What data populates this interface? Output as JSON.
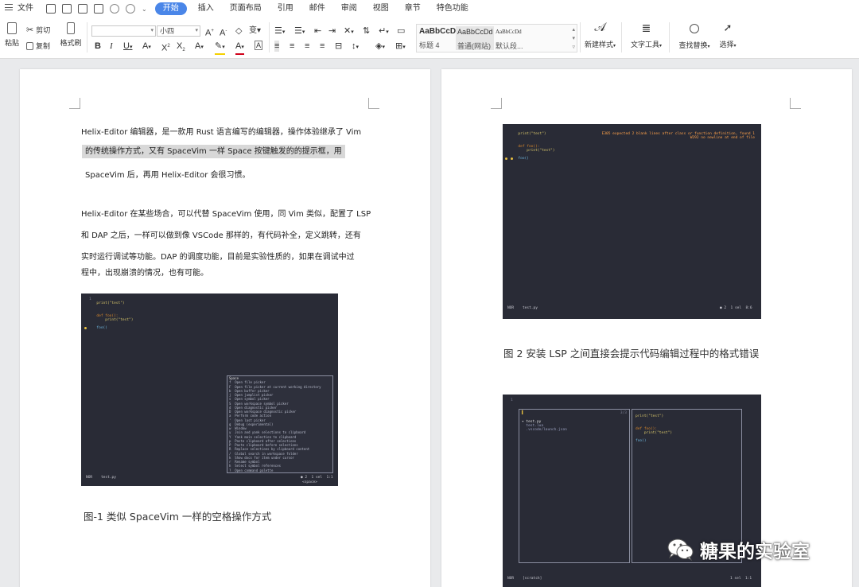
{
  "menubar": {
    "file": "文件",
    "tabs": [
      "开始",
      "插入",
      "页面布局",
      "引用",
      "邮件",
      "审阅",
      "视图",
      "章节",
      "特色功能"
    ]
  },
  "ribbon": {
    "paste": "粘贴",
    "cut": "剪切",
    "copy": "复制",
    "format_painter": "格式刷",
    "font_name": "",
    "font_size": "小四",
    "styles": [
      {
        "preview": "AaBbCcDd",
        "name": "标题 4"
      },
      {
        "preview": "AaBbCcDd",
        "name": "普通(网站)"
      },
      {
        "preview": "AaBbCcDd",
        "name": "默认段..."
      }
    ],
    "new_style": "新建样式",
    "text_tools": "文字工具",
    "find_replace": "查找替换",
    "select": "选择"
  },
  "page1": {
    "para1": [
      "Helix-Editor 编辑器，是一款用 Rust 语言编写的编辑器，操作体验继承了 Vim",
      "的传统操作方式，又有 SpaceVim 一样 Space 按键触发的的提示框，用",
      "SpaceVim 后，再用 Helix-Editor 会很习惯。"
    ],
    "para2": [
      "Helix-Editor 在某些场合，可以代替 SpaceVim 使用，同 Vim 类似，配置了 LSP",
      "和 DAP 之后，一样可以做到像 VSCode 那样的，有代码补全，定义跳转，还有",
      "实时运行调试等功能。DAP 的调度功能，目前是实验性质的，如果在调试中过",
      "程中，出现崩溃的情况，也有可能。"
    ],
    "caption": "图-1  类似 SpaceVim 一样的空格操作方式",
    "shot": {
      "code": [
        "1  ",
        "  print(\"test\")",
        "",
        "",
        "  def foo():",
        "      print(\"test\")",
        "",
        "  foo()"
      ],
      "popup_title": "Space",
      "popup_items": [
        "f  Open file picker",
        "F  Open file picker at current working directory",
        "b  Open buffer picker",
        "j  Open jumplist picker",
        "s  Open symbol picker",
        "S  Open workspace symbol picker",
        "d  Open diagnostic picker",
        "D  Open workspace diagnostic picker",
        "a  Perform code action",
        "'  Open last picker",
        "g  Debug (experimental)",
        "w  Window",
        "y  Join and yank selections to clipboard",
        "Y  Yank main selection to clipboard",
        "p  Paste clipboard after selections",
        "P  Paste clipboard before selections",
        "R  Replace selections by clipboard content",
        "/  Global search in workspace folder",
        "k  Show docs for item under cursor",
        "r  Rename symbol",
        "h  Select symbol references",
        "?  Open command palette"
      ],
      "status_left": "NOR    test.py",
      "status_right": "● 2  1 sel  1:1",
      "status_key": "<space>"
    }
  },
  "page2": {
    "shot1": {
      "code": [
        "  print(\"test\")",
        "",
        "",
        "  def foo():",
        "      print(\"test\")",
        "",
        "  foo()"
      ],
      "err1": "E305 expected 2 blank lines after class or function definition, found 1",
      "err2": "W292 no newline at end of file",
      "status_left": "NOR    test.py",
      "status_right": "● 2  1 sel  8:6"
    },
    "caption": "图 2 安装 LSP 之间直接会提示代码编辑过程中的格式错误",
    "shot2": {
      "line": "1 ",
      "count": "3/3",
      "files": [
        "▾ test.py",
        "  test.lua",
        "  .vscode/launch.json"
      ],
      "preview": [
        "print(\"test\")",
        "",
        "",
        "def foo():",
        "    print(\"test\")",
        "",
        "foo()"
      ],
      "status_left": "NOR    [scratch]",
      "status_right": "1 sel  1:1"
    }
  },
  "watermark": "糖果的实验室"
}
